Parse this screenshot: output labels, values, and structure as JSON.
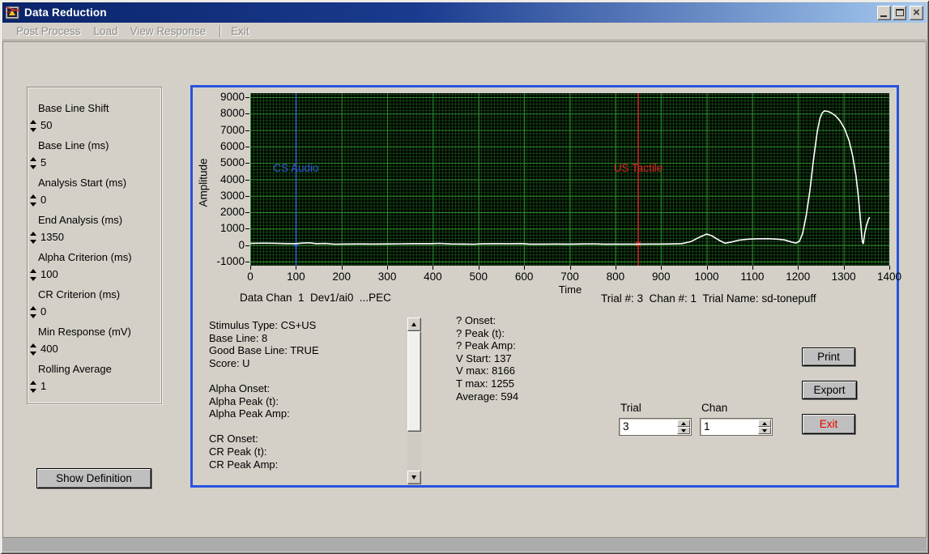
{
  "window": {
    "title": "Data Reduction"
  },
  "menu": {
    "items": [
      "Post Process",
      "Load",
      "View Response"
    ],
    "exit": "Exit"
  },
  "panel": {
    "items": [
      {
        "label": "Base Line Shift",
        "value": "50"
      },
      {
        "label": "Base Line (ms)",
        "value": "5"
      },
      {
        "label": "Analysis Start (ms)",
        "value": "0"
      },
      {
        "label": "End Analysis (ms)",
        "value": "1350"
      },
      {
        "label": "Alpha Criterion (ms)",
        "value": "100"
      },
      {
        "label": "CR Criterion (ms)",
        "value": "0"
      },
      {
        "label": "Min Response (mV)",
        "value": "400"
      },
      {
        "label": "Rolling Average",
        "value": "1"
      }
    ]
  },
  "show_definition_label": "Show Definition",
  "chart_data": {
    "type": "line",
    "title": "",
    "xlabel": "Time",
    "ylabel": "Amplitude",
    "xlim": [
      0,
      1400
    ],
    "ylim": [
      -1000,
      9000
    ],
    "xticks": [
      0,
      100,
      200,
      300,
      400,
      500,
      600,
      700,
      800,
      900,
      1000,
      1100,
      1200,
      1300,
      1400
    ],
    "yticks": [
      9000,
      8000,
      7000,
      6000,
      5000,
      4000,
      3000,
      2000,
      1000,
      0,
      -1000
    ],
    "grid": true,
    "plot_bg": "#000000",
    "grid_major_color": "#2c8a2c",
    "grid_minor_color": "#144614",
    "legend_position": "none",
    "series": [
      {
        "name": "response-waveform",
        "color": "#ffffff",
        "points": [
          [
            0,
            115
          ],
          [
            25,
            125
          ],
          [
            50,
            120
          ],
          [
            75,
            100
          ],
          [
            100,
            95
          ],
          [
            115,
            130
          ],
          [
            130,
            145
          ],
          [
            145,
            95
          ],
          [
            165,
            105
          ],
          [
            185,
            60
          ],
          [
            210,
            70
          ],
          [
            240,
            75
          ],
          [
            270,
            70
          ],
          [
            300,
            75
          ],
          [
            330,
            85
          ],
          [
            360,
            95
          ],
          [
            395,
            95
          ],
          [
            415,
            110
          ],
          [
            440,
            75
          ],
          [
            465,
            70
          ],
          [
            490,
            60
          ],
          [
            510,
            90
          ],
          [
            540,
            95
          ],
          [
            570,
            90
          ],
          [
            595,
            100
          ],
          [
            612,
            62
          ],
          [
            640,
            65
          ],
          [
            670,
            70
          ],
          [
            700,
            65
          ],
          [
            725,
            75
          ],
          [
            750,
            85
          ],
          [
            775,
            62
          ],
          [
            800,
            65
          ],
          [
            825,
            62
          ],
          [
            850,
            65
          ],
          [
            875,
            70
          ],
          [
            900,
            70
          ],
          [
            925,
            80
          ],
          [
            945,
            95
          ],
          [
            965,
            210
          ],
          [
            985,
            500
          ],
          [
            1000,
            675
          ],
          [
            1012,
            560
          ],
          [
            1025,
            330
          ],
          [
            1040,
            120
          ],
          [
            1055,
            195
          ],
          [
            1070,
            300
          ],
          [
            1090,
            365
          ],
          [
            1110,
            390
          ],
          [
            1135,
            395
          ],
          [
            1155,
            365
          ],
          [
            1170,
            320
          ],
          [
            1185,
            195
          ],
          [
            1195,
            130
          ],
          [
            1203,
            230
          ],
          [
            1210,
            700
          ],
          [
            1218,
            1800
          ],
          [
            1226,
            3300
          ],
          [
            1234,
            5200
          ],
          [
            1242,
            6900
          ],
          [
            1248,
            7700
          ],
          [
            1253,
            8050
          ],
          [
            1258,
            8166
          ],
          [
            1265,
            8140
          ],
          [
            1272,
            8060
          ],
          [
            1282,
            7870
          ],
          [
            1292,
            7560
          ],
          [
            1302,
            7080
          ],
          [
            1312,
            6350
          ],
          [
            1320,
            5400
          ],
          [
            1327,
            4200
          ],
          [
            1332,
            3000
          ],
          [
            1336,
            1800
          ],
          [
            1339,
            800
          ],
          [
            1341,
            200
          ],
          [
            1343,
            100
          ],
          [
            1346,
            700
          ],
          [
            1350,
            1200
          ],
          [
            1354,
            1550
          ],
          [
            1357,
            1700
          ]
        ]
      }
    ],
    "cursors": [
      {
        "label": "CS Audio",
        "x": 100,
        "color": "#2e5bd8",
        "label_y": 4650,
        "marker_y": 0,
        "marker": "dot"
      },
      {
        "label": "US Tactile",
        "x": 850,
        "color": "#e02020",
        "label_y": 4650,
        "marker_y": 65,
        "marker": "star"
      }
    ]
  },
  "chart_footer": {
    "data_chan": "Data Chan  1  Dev1/ai0  ...PEC",
    "trial_info": "Trial #: 3  Chan #: 1  Trial Name: sd-tonepuff"
  },
  "results_box": {
    "lines": [
      "Stimulus Type: CS+US",
      "Base Line: 8",
      "Good Base Line: TRUE",
      "Score: U",
      "",
      "Alpha Onset:",
      "Alpha Peak (t):",
      "Alpha Peak Amp:",
      "",
      "CR Onset:",
      "CR Peak (t):",
      "CR Peak Amp:"
    ]
  },
  "summary": {
    "lines": [
      "? Onset:",
      "? Peak (t):",
      "? Peak Amp:",
      "V Start: 137",
      "V max: 8166",
      "T max: 1255",
      "Average: 594"
    ]
  },
  "selectors": {
    "trial": {
      "label": "Trial",
      "value": "3"
    },
    "chan": {
      "label": "Chan",
      "value": "1"
    }
  },
  "action_buttons": {
    "print": "Print",
    "export": "Export",
    "exit": "Exit"
  },
  "colors": {
    "accent_border": "#2a52dd",
    "cs_color": "#2e5bd8",
    "us_color": "#e02020",
    "titlebar_start": "#0A246A",
    "titlebar_end": "#A6CAF0"
  }
}
